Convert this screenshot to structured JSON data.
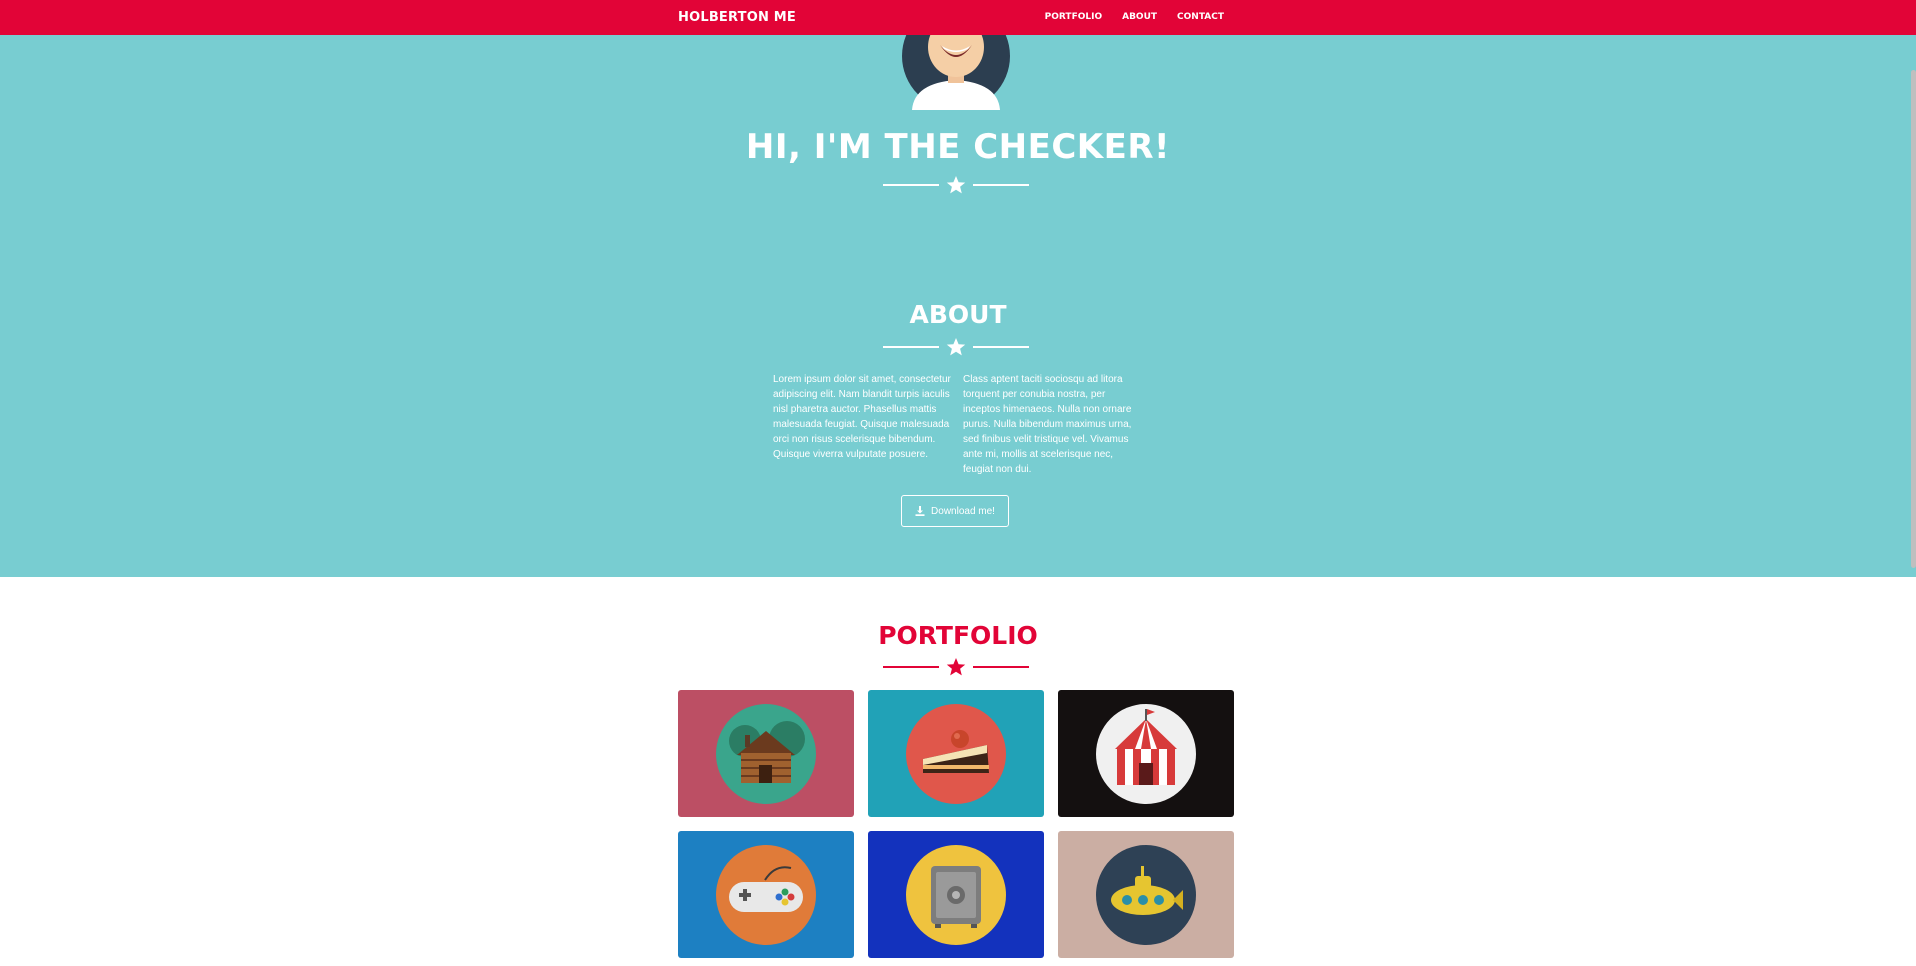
{
  "navbar": {
    "brand": "HOLBERTON ME",
    "links": [
      "PORTFOLIO",
      "ABOUT",
      "CONTACT"
    ],
    "background": "#e20437"
  },
  "hero": {
    "title": "HI, I'M THE CHECKER!",
    "background": "#78cdd1"
  },
  "about": {
    "title": "ABOUT",
    "paragraphs": [
      "Lorem ipsum dolor sit amet, consectetur adipiscing elit. Nam blandit turpis iaculis nisl pharetra auctor. Phasellus mattis malesuada feugiat. Quisque malesuada orci non risus scelerisque bibendum. Quisque viverra vulputate posuere.",
      "Class aptent taciti sociosqu ad litora torquent per conubia nostra, per inceptos himenaeos. Nulla non ornare purus. Nulla bibendum maximus urna, sed finibus velit tristique vel. Vivamus ante mi, mollis at scelerisque nec, feugiat non dui."
    ],
    "download_label": "Download me!"
  },
  "portfolio": {
    "title": "PORTFOLIO",
    "accent": "#e20437",
    "tiles": [
      {
        "icon": "cabin-icon",
        "background": "#bc4f64"
      },
      {
        "icon": "cake-icon",
        "background": "#21a2b7"
      },
      {
        "icon": "circus-tent-icon",
        "background": "#141010"
      },
      {
        "icon": "game-controller-icon",
        "background": "#1d80c2"
      },
      {
        "icon": "safe-icon",
        "background": "#1332bd"
      },
      {
        "icon": "submarine-icon",
        "background": "#cbaea3"
      }
    ]
  }
}
